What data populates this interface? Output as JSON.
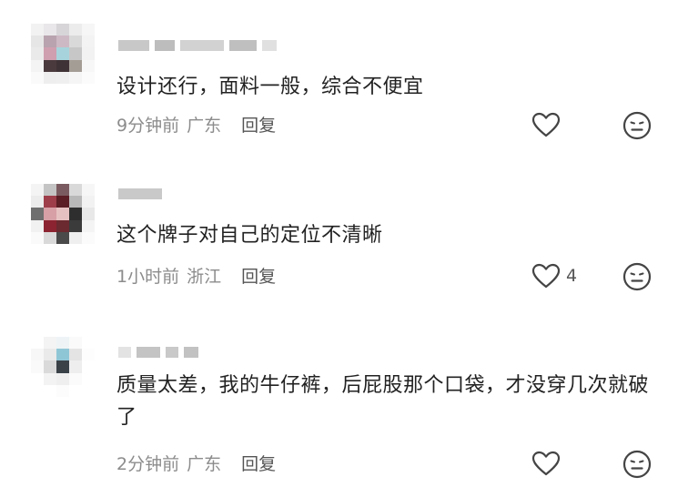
{
  "comments": [
    {
      "text": "设计还行，面料一般，综合不便宜",
      "time": "9分钟前",
      "location": "广东",
      "reply_label": "回复",
      "like_count": ""
    },
    {
      "text": "这个牌子对自己的定位不清晰",
      "time": "1小时前",
      "location": "浙江",
      "reply_label": "回复",
      "like_count": "4"
    },
    {
      "text": "质量太差，我的牛仔裤，后屁股那个口袋，才没穿几次就破了",
      "time": "2分钟前",
      "location": "广东",
      "reply_label": "回复",
      "like_count": ""
    }
  ],
  "icons": {
    "like": "heart-outline-icon",
    "dislike": "neutral-face-icon"
  },
  "colors": {
    "text": "#222222",
    "meta": "#8c8c8c",
    "reply": "#555555",
    "icon_stroke": "#444444"
  }
}
